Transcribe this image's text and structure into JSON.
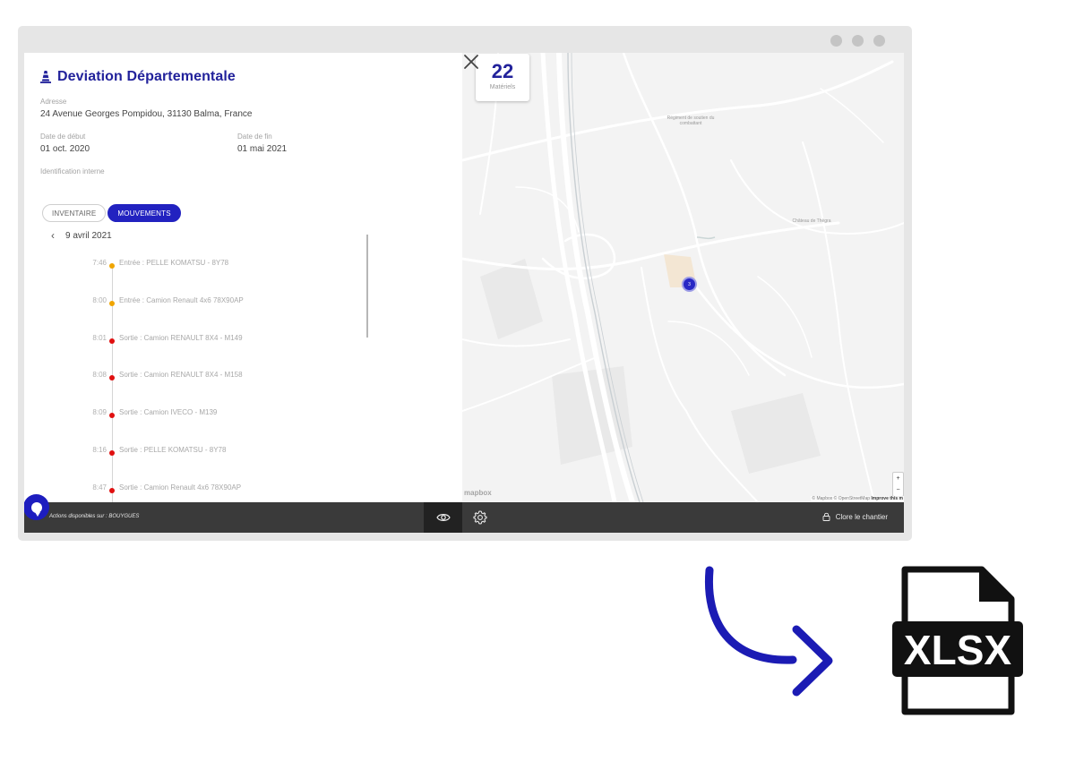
{
  "site": {
    "title": "Deviation Départementale",
    "address_label": "Adresse",
    "address": "24 Avenue Georges Pompidou, 31130 Balma, France",
    "start_label": "Date de début",
    "start_date": "01 oct. 2020",
    "end_label": "Date de fin",
    "end_date": "01 mai 2021",
    "internal_id_label": "Identification interne"
  },
  "tabs": [
    {
      "label": "INVENTAIRE",
      "active": false
    },
    {
      "label": "MOUVEMENTS",
      "active": true
    }
  ],
  "date_nav": {
    "date": "9 avril 2021"
  },
  "movements": [
    {
      "time": "7:46",
      "text": "Entrée : PELLE KOMATSU - 8Y78",
      "type": "entry",
      "color": "#f0a500"
    },
    {
      "time": "8:00",
      "text": "Entrée : Camion Renault 4x6 78X90AP",
      "type": "entry",
      "color": "#f0a500"
    },
    {
      "time": "8:01",
      "text": "Sortie : Camion RENAULT 8X4 - M149",
      "type": "exit",
      "color": "#e01010"
    },
    {
      "time": "8:08",
      "text": "Sortie : Camion RENAULT 8X4 - M158",
      "type": "exit",
      "color": "#e01010"
    },
    {
      "time": "8:09",
      "text": "Sortie : Camion IVECO - M139",
      "type": "exit",
      "color": "#e01010"
    },
    {
      "time": "8:16",
      "text": "Sortie : PELLE KOMATSU - 8Y78",
      "type": "exit",
      "color": "#e01010"
    },
    {
      "time": "8:47",
      "text": "Sortie : Camion Renault 4x6 78X90AP",
      "type": "exit",
      "color": "#e01010"
    }
  ],
  "map": {
    "counter_value": "22",
    "counter_unit": "Matériels",
    "labels": {
      "regiment": "Régiment de soutien du combattant",
      "chateau": "Château de Thègra"
    },
    "cluster_count": "3",
    "zoom_in": "+",
    "zoom_out": "−",
    "logo": "mapbox",
    "attribution": "© Mapbox © OpenStreetMap",
    "improve": "Improve this m"
  },
  "bottom_bar": {
    "actions_text": "Actions disponibles sur : BOUYGUES",
    "close_site_label": "Clore le chantier"
  },
  "export": {
    "file_label": "XLSX"
  },
  "colors": {
    "brand": "#22229b",
    "accent": "#2222c0",
    "entry": "#f0a500",
    "exit": "#e01010",
    "bar": "#3a3a3a"
  }
}
